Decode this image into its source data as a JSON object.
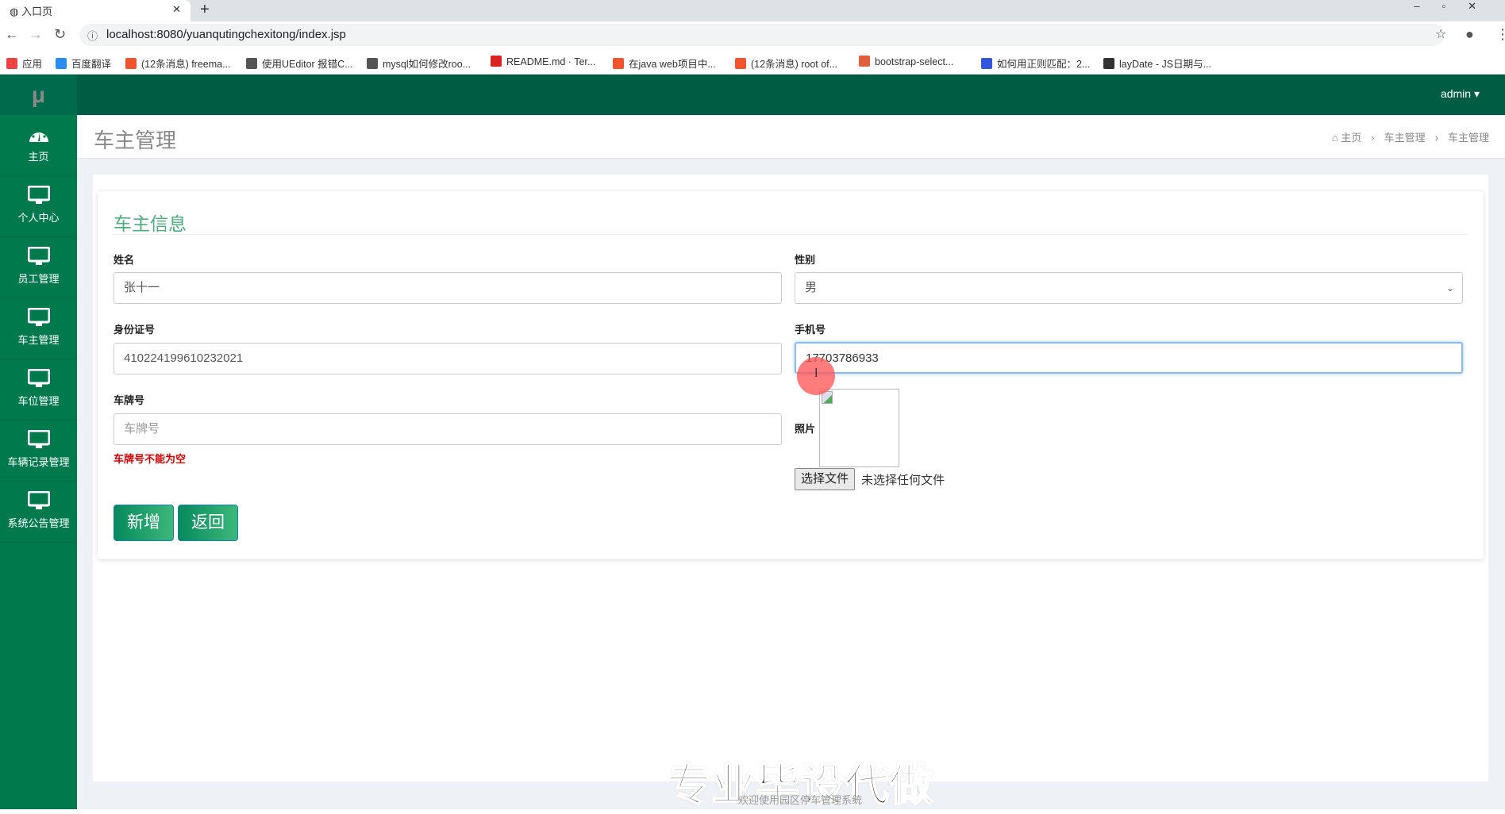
{
  "browser": {
    "tab_title": "入口页",
    "url": "localhost:8080/yuanqutingchexitong/index.jsp",
    "bookmarks": [
      {
        "label": "应用",
        "color": "#e44"
      },
      {
        "label": "百度翻译",
        "color": "#2b8cf2"
      },
      {
        "label": "(12条消息) freema...",
        "color": "#f0542d"
      },
      {
        "label": "使用UEditor 报错C...",
        "color": "#555"
      },
      {
        "label": "mysql如何修改roo...",
        "color": "#555"
      },
      {
        "label": "README.md · Ter...",
        "color": "#d22"
      },
      {
        "label": "在java web项目中...",
        "color": "#f0542d"
      },
      {
        "label": "(12条消息) root of...",
        "color": "#f0542d"
      },
      {
        "label": "bootstrap-select...",
        "color": "#e0603d"
      },
      {
        "label": "如何用正则匹配：2...",
        "color": "#3355dd"
      },
      {
        "label": "layDate - JS日期与...",
        "color": "#333"
      }
    ]
  },
  "header": {
    "logo": "μ",
    "user": "admin ▾"
  },
  "sidebar": {
    "items": [
      {
        "label": "主页",
        "icon": "dashboard-icon"
      },
      {
        "label": "个人中心",
        "icon": "monitor-icon"
      },
      {
        "label": "员工管理",
        "icon": "monitor-icon"
      },
      {
        "label": "车主管理",
        "icon": "monitor-icon"
      },
      {
        "label": "车位管理",
        "icon": "monitor-icon"
      },
      {
        "label": "车辆记录管理",
        "icon": "monitor-icon"
      },
      {
        "label": "系统公告管理",
        "icon": "monitor-icon"
      }
    ]
  },
  "page": {
    "title": "车主管理",
    "breadcrumb": [
      "主页",
      "车主管理",
      "车主管理"
    ]
  },
  "form": {
    "heading": "车主信息",
    "name": {
      "label": "姓名",
      "value": "张十一"
    },
    "gender": {
      "label": "性别",
      "value": "男"
    },
    "id_card": {
      "label": "身份证号",
      "value": "410224199610232021"
    },
    "phone": {
      "label": "手机号",
      "value": "17703786933"
    },
    "plate": {
      "label": "车牌号",
      "placeholder": "车牌号",
      "error": "车牌号不能为空"
    },
    "photo": {
      "label": "照片",
      "choose": "选择文件",
      "no_file": "未选择任何文件"
    },
    "submit": "新增",
    "back": "返回"
  },
  "footer": {
    "watermark": "专业毕设代做",
    "text": "欢迎使用园区停车管理系统"
  }
}
